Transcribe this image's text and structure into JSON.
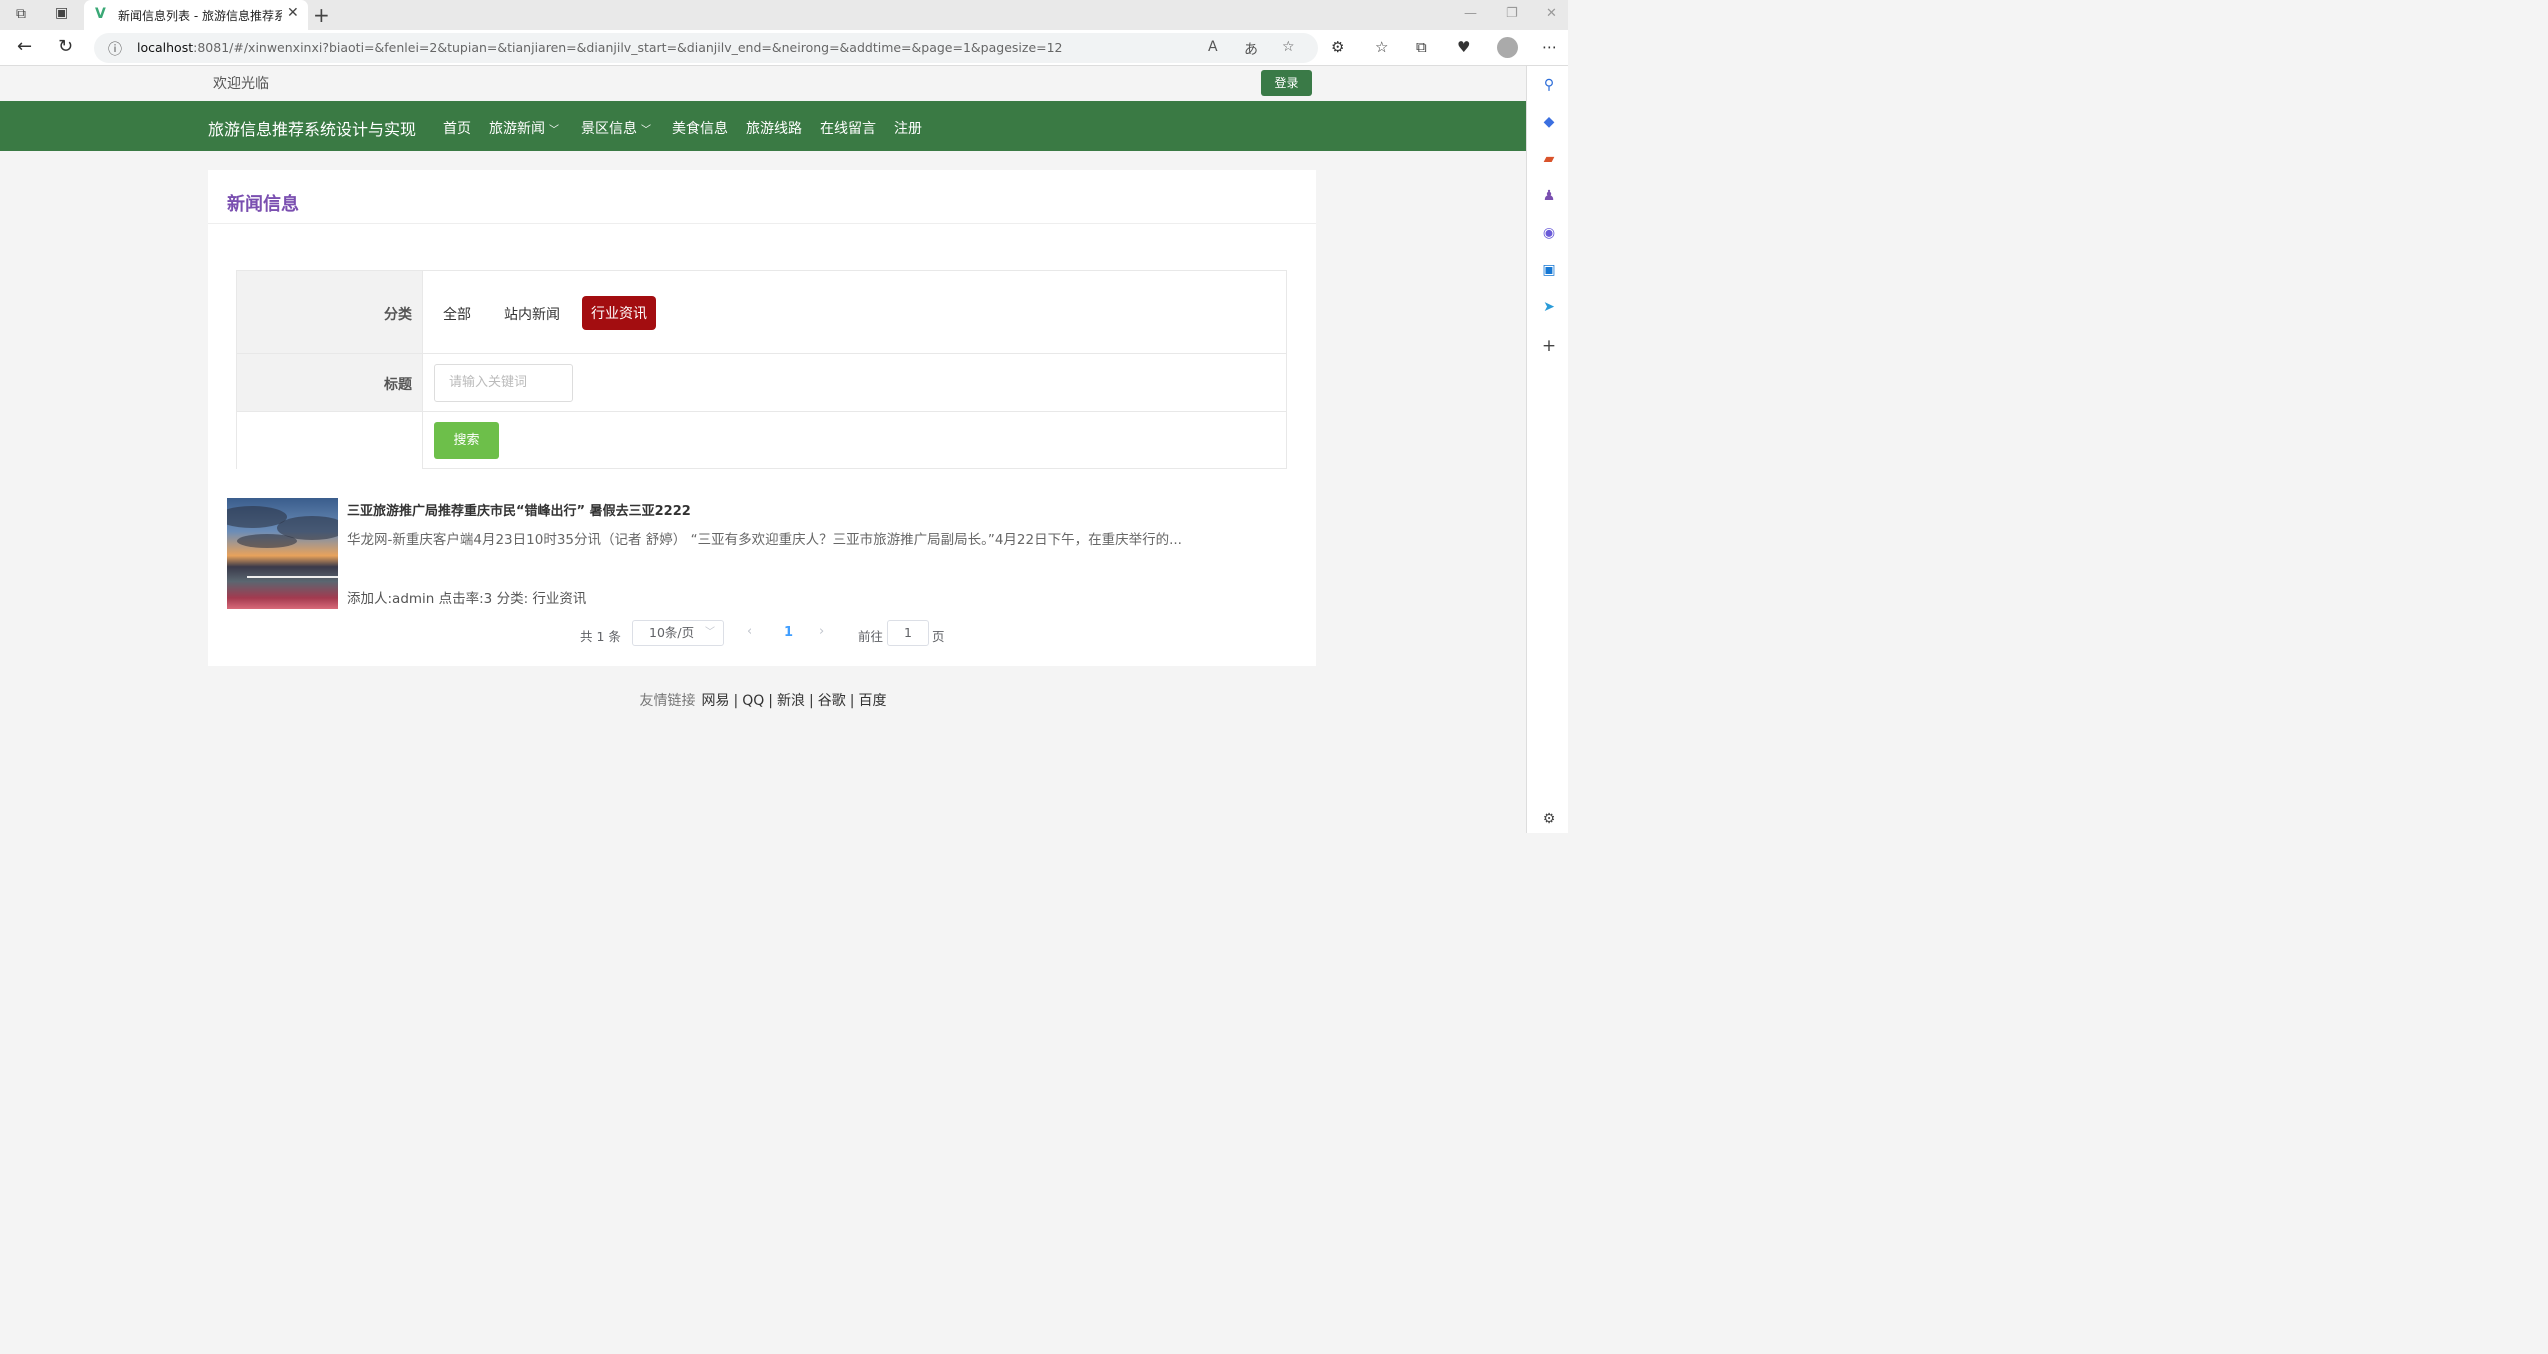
{
  "browser": {
    "tab_title": "新闻信息列表 - 旅游信息推荐系统",
    "url_host": "localhost",
    "url_rest": ":8081/#/xinwenxinxi?biaoti=&fenlei=2&tupian=&tianjiaren=&dianjilv_start=&dianjilv_end=&neirong=&addtime=&page=1&pagesize=12"
  },
  "topbar": {
    "welcome": "欢迎光临",
    "login": "登录"
  },
  "nav": {
    "brand": "旅游信息推荐系统设计与实现",
    "items": [
      "首页",
      "旅游新闻",
      "景区信息",
      "美食信息",
      "旅游线路",
      "在线留言",
      "注册"
    ]
  },
  "card": {
    "title": "新闻信息"
  },
  "filter": {
    "category_label": "分类",
    "categories": [
      "全部",
      "站内新闻",
      "行业资讯"
    ],
    "active_category": "行业资讯",
    "title_label": "标题",
    "keyword_placeholder": "请输入关键词",
    "search": "搜索"
  },
  "news": [
    {
      "title": "三亚旅游推广局推荐重庆市民“错峰出行” 暑假去三亚2222",
      "desc": "华龙网-新重庆客户端4月23日10时35分讯（记者 舒婷） “三亚有多欢迎重庆人？三亚市旅游推广局副局长。”4月22日下午，在重庆举行的...",
      "meta": "添加人:admin  点击率:3  分类: 行业资讯"
    }
  ],
  "pagination": {
    "total": "共 1 条",
    "page_size": "10条/页",
    "current": "1",
    "goto_label": "前往",
    "goto_value": "1",
    "page_unit": "页"
  },
  "footer": {
    "label": "友情链接",
    "links": [
      "网易",
      "QQ",
      "新浪",
      "谷歌",
      "百度"
    ]
  },
  "colors": {
    "nav_green": "#3a7a44",
    "active_category": "#a30d10",
    "search_button": "#6dbf4a",
    "card_title": "#7a4fb0",
    "page_link": "#409eff"
  }
}
